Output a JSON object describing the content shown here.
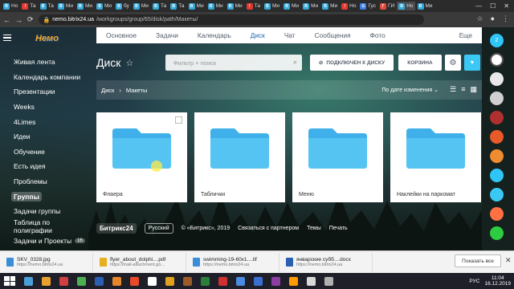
{
  "browser": {
    "tabs": [
      {
        "label": "Но",
        "color": "#35a8d8",
        "glyph": "B"
      },
      {
        "label": "Та",
        "color": "#e23a33",
        "glyph": "!"
      },
      {
        "label": "Та",
        "color": "#35a8d8",
        "glyph": "B"
      },
      {
        "label": "Ми",
        "color": "#35a8d8",
        "glyph": "B"
      },
      {
        "label": "Ми",
        "color": "#35a8d8",
        "glyph": "B"
      },
      {
        "label": "Ми",
        "color": "#35a8d8",
        "glyph": "B"
      },
      {
        "label": "бу",
        "color": "#35a8d8",
        "glyph": "B"
      },
      {
        "label": "Ми",
        "color": "#35a8d8",
        "glyph": "B"
      },
      {
        "label": "Та",
        "color": "#35a8d8",
        "glyph": "B"
      },
      {
        "label": "Та",
        "color": "#35a8d8",
        "glyph": "B"
      },
      {
        "label": "Ми",
        "color": "#35a8d8",
        "glyph": "B"
      },
      {
        "label": "Ми",
        "color": "#35a8d8",
        "glyph": "B"
      },
      {
        "label": "Ми",
        "color": "#35a8d8",
        "glyph": "B"
      },
      {
        "label": "Та",
        "color": "#e23a33",
        "glyph": "!"
      },
      {
        "label": "Ми",
        "color": "#35a8d8",
        "glyph": "B"
      },
      {
        "label": "Ми",
        "color": "#35a8d8",
        "glyph": "B"
      },
      {
        "label": "Ми",
        "color": "#35a8d8",
        "glyph": "B"
      },
      {
        "label": "Ми",
        "color": "#35a8d8",
        "glyph": "B"
      },
      {
        "label": "Но",
        "color": "#e23a33",
        "glyph": "!"
      },
      {
        "label": "Гус",
        "color": "#3f7ee8",
        "glyph": "G"
      },
      {
        "label": "ГИ",
        "color": "#e24a3a",
        "glyph": "Г"
      },
      {
        "label": "Но",
        "color": "#35a8d8",
        "glyph": "B"
      },
      {
        "label": "Ми",
        "color": "#35a8d8",
        "glyph": "B"
      }
    ],
    "url_host": "nemo.bitrix24.ua",
    "url_path": "/workgroups/group/65/disk/path/Макеты/"
  },
  "sidebar": {
    "logo": "Немо",
    "items": [
      {
        "label": "Живая лента"
      },
      {
        "label": "Календарь компании"
      },
      {
        "label": "Презентации"
      },
      {
        "label": "Weeks"
      },
      {
        "label": "4Limes"
      },
      {
        "label": "Идеи"
      },
      {
        "label": "Обучение"
      },
      {
        "label": "Есть идея"
      },
      {
        "label": "Проблемы"
      },
      {
        "label": "Группы"
      },
      {
        "label": "Задачи группы"
      },
      {
        "label": "Таблица по полиграфии"
      },
      {
        "label": "Задачи и Проекты",
        "badge": "16"
      }
    ]
  },
  "topnav": {
    "items": [
      "Основное",
      "Задачи",
      "Календарь",
      "Диск",
      "Чат",
      "Сообщения",
      "Фото"
    ],
    "active": 3,
    "more": "Еще"
  },
  "page": {
    "title": "Диск",
    "search_placeholder": "Фильтр + поиск",
    "connect_label": "ПОДКЛЮЧЕН К ДИСКУ",
    "trash_label": "КОРЗИНА",
    "breadcrumb": [
      "Диск",
      "Макеты"
    ],
    "sort_label": "По дате изменения"
  },
  "folders": [
    {
      "name": "Флаера"
    },
    {
      "name": "Таблички"
    },
    {
      "name": "Меню"
    },
    {
      "name": "Наклейки на паркомат"
    }
  ],
  "footer": {
    "brand": "Битрикс24",
    "lang": "Русский",
    "copyright": "© «Битрикс», 2019",
    "partner": "Связаться с партнером",
    "themes": "Темы",
    "print": "Печать"
  },
  "rightbar": [
    {
      "color": "#2fc6f6",
      "glyph": "2"
    },
    {
      "color": "#ffffff",
      "glyph": ""
    },
    {
      "color": "#e8e8e8",
      "glyph": ""
    },
    {
      "color": "#d0d0d0",
      "glyph": ""
    },
    {
      "color": "#b03030",
      "glyph": ""
    },
    {
      "color": "#e85a2a",
      "glyph": ""
    },
    {
      "color": "#f08c30",
      "glyph": ""
    },
    {
      "color": "#2fc6f6",
      "glyph": ""
    },
    {
      "color": "#3bc8f5",
      "glyph": ""
    },
    {
      "color": "#ff7043",
      "glyph": ""
    },
    {
      "color": "#2ecc40",
      "glyph": ""
    }
  ],
  "downloads": [
    {
      "name": "SKV_0328.jpg",
      "url": "https://nemo.bitrix24.ua",
      "color": "#3b8dd8"
    },
    {
      "name": "flyer_about_dolphi....pdf",
      "url": "https://mail-attachment.go...",
      "color": "#e8b020"
    },
    {
      "name": "swimming-19-60x1....tif",
      "url": "https://nemo.bitrix24.ua",
      "color": "#3b8dd8"
    },
    {
      "name": "январские субб....docx",
      "url": "https://nemo.bitrix24.ua",
      "color": "#2b5fb0"
    }
  ],
  "show_all_label": "Показать все",
  "tray": {
    "lang": "РУС",
    "time": "11:04",
    "date": "16.12.2019"
  },
  "taskbar_apps": [
    "#4a9fd8",
    "#e8a030",
    "#d04040",
    "#4caf50",
    "#2b5fb0",
    "#e6862a",
    "#e84a2a",
    "#ffffff",
    "#e0a020",
    "#9c5c2a",
    "#2a7f3a",
    "#cf3030",
    "#4a8adf",
    "#3a6fd0",
    "#8a3fa0",
    "#ff9a00",
    "#d8d8d8",
    "#b0b0b0"
  ]
}
